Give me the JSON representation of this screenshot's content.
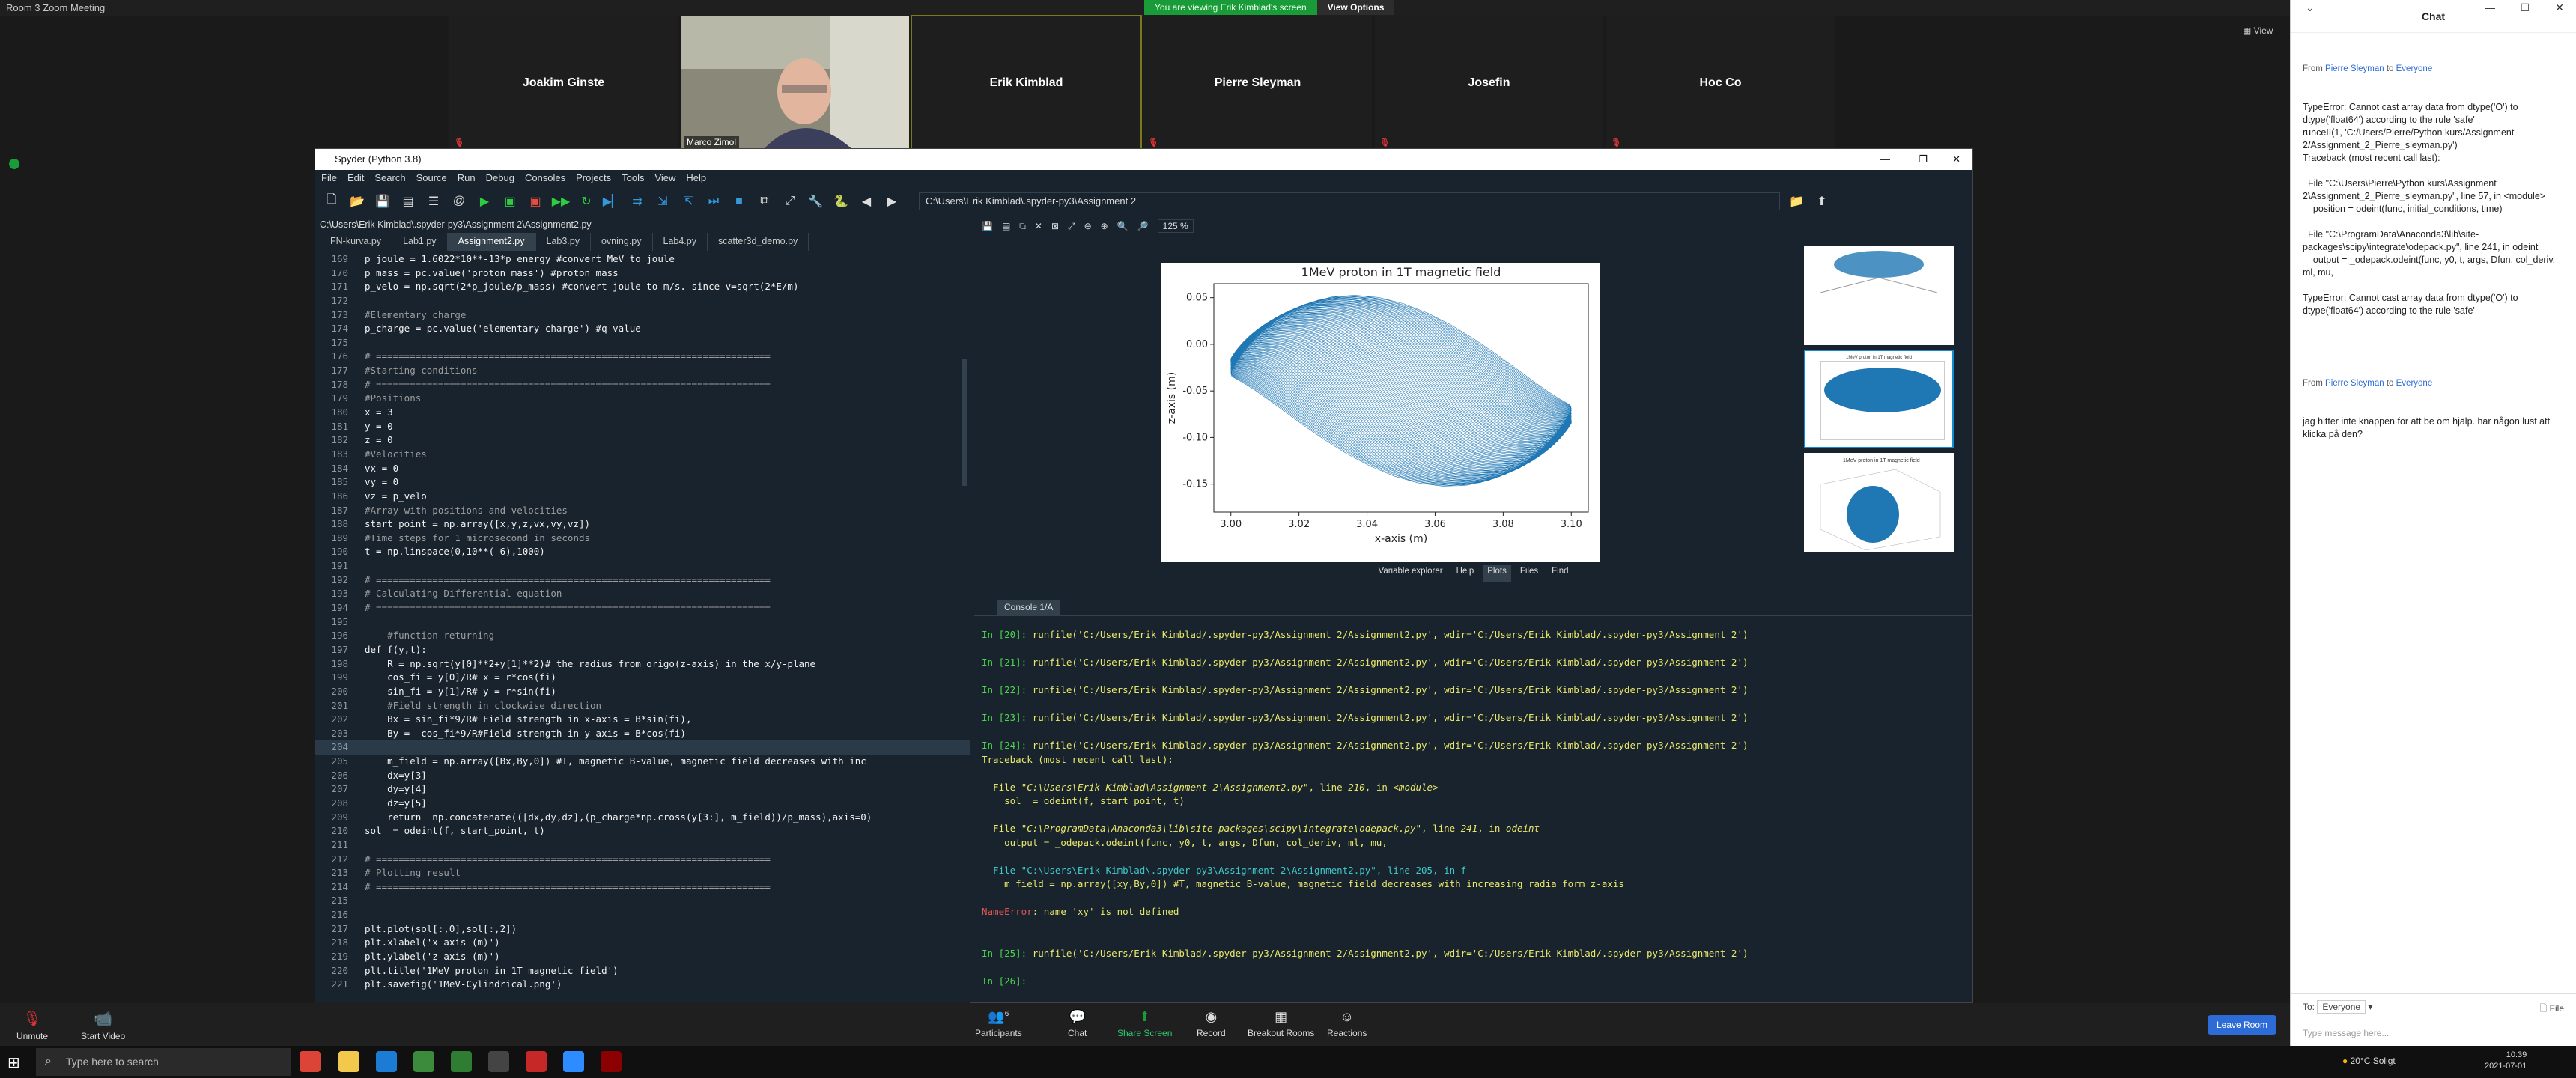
{
  "zoom": {
    "window_title": "Room 3  Zoom Meeting",
    "share_banner": "You are viewing Erik Kimblad's screen",
    "view_options": "View Options",
    "view_label": "View",
    "participants": [
      {
        "name": "Joakim Ginste",
        "muted": true,
        "video": false
      },
      {
        "name": "Marco Zimol",
        "muted": false,
        "video": true
      },
      {
        "name": "Erik Kimblad",
        "muted": false,
        "video": false,
        "active": true
      },
      {
        "name": "Pierre Sleyman",
        "muted": true,
        "video": false
      },
      {
        "name": "Josefin",
        "muted": true,
        "video": false
      },
      {
        "name": "Hoc Co",
        "muted": true,
        "video": false
      }
    ],
    "bottom": {
      "unmute": "Unmute",
      "start_video": "Start Video",
      "participants": "Participants",
      "participants_count": "6",
      "chat": "Chat",
      "share_screen": "Share Screen",
      "record": "Record",
      "breakout": "Breakout Rooms",
      "reactions": "Reactions",
      "leave": "Leave Room"
    }
  },
  "chat": {
    "title": "Chat",
    "messages": [
      {
        "from": "Pierre Sleyman",
        "to": "Everyone",
        "text": "TypeError: Cannot cast array data from dtype('O') to dtype('float64') according to the rule 'safe'\nrunceII(1, 'C:/Users/Pierre/Python kurs/Assignment 2/Assignment_2_Pierre_sleyman.py')\nTraceback (most recent call last):\n\n  File \"C:\\Users\\Pierre\\Python kurs\\Assignment 2\\Assignment_2_Pierre_sleyman.py\", line 57, in <module>\n    position = odeint(func, initial_conditions, time)\n\n  File \"C:\\ProgramData\\Anaconda3\\lib\\site-packages\\scipy\\integrate\\odepack.py\", line 241, in odeint\n    output = _odepack.odeint(func, y0, t, args, Dfun, col_deriv, ml, mu,\n\nTypeError: Cannot cast array data from dtype('O') to dtype('float64') according to the rule 'safe'"
      },
      {
        "from": "Pierre Sleyman",
        "to": "Everyone",
        "text": "jag hitter inte knappen för att be om hjälp. har någon lust att klicka på den?"
      }
    ],
    "to_label": "To:",
    "to_value": "Everyone",
    "file_label": "File",
    "input_placeholder": "Type message here..."
  },
  "spyder": {
    "title": "Spyder (Python 3.8)",
    "menu": [
      "File",
      "Edit",
      "Search",
      "Source",
      "Run",
      "Debug",
      "Consoles",
      "Projects",
      "Tools",
      "View",
      "Help"
    ],
    "path": "C:\\Users\\Erik Kimblad\\.spyder-py3\\Assignment 2",
    "file_path": "C:\\Users\\Erik Kimblad\\.spyder-py3\\Assignment 2\\Assignment2.py",
    "tabs": [
      "FN-kurva.py",
      "Lab1.py",
      "Assignment2.py",
      "Lab3.py",
      "ovning.py",
      "Lab4.py",
      "scatter3d_demo.py"
    ],
    "selected_tab": "Assignment2.py",
    "code": [
      {
        "n": "169",
        "t": "p_joule = 1.6022*10**-13*p_energy #convert MeV to joule"
      },
      {
        "n": "170",
        "t": "p_mass = pc.value('proton mass') #proton mass"
      },
      {
        "n": "171",
        "t": "p_velo = np.sqrt(2*p_joule/p_mass) #convert joule to m/s. since v=sqrt(2*E/m)"
      },
      {
        "n": "172",
        "t": ""
      },
      {
        "n": "173",
        "t": "#Elementary charge"
      },
      {
        "n": "174",
        "t": "p_charge = pc.value('elementary charge') #q-value"
      },
      {
        "n": "175",
        "t": ""
      },
      {
        "n": "176",
        "t": "# ======================================================================"
      },
      {
        "n": "177",
        "t": "#Starting conditions"
      },
      {
        "n": "178",
        "t": "# ======================================================================"
      },
      {
        "n": "179",
        "t": "#Positions"
      },
      {
        "n": "180",
        "t": "x = 3"
      },
      {
        "n": "181",
        "t": "y = 0"
      },
      {
        "n": "182",
        "t": "z = 0"
      },
      {
        "n": "183",
        "t": "#Velocities"
      },
      {
        "n": "184",
        "t": "vx = 0"
      },
      {
        "n": "185",
        "t": "vy = 0"
      },
      {
        "n": "186",
        "t": "vz = p_velo"
      },
      {
        "n": "187",
        "t": "#Array with positions and velocities"
      },
      {
        "n": "188",
        "t": "start_point = np.array([x,y,z,vx,vy,vz])"
      },
      {
        "n": "189",
        "t": "#Time steps for 1 microsecond in seconds"
      },
      {
        "n": "190",
        "t": "t = np.linspace(0,10**(-6),1000)"
      },
      {
        "n": "191",
        "t": ""
      },
      {
        "n": "192",
        "t": "# ======================================================================"
      },
      {
        "n": "193",
        "t": "# Calculating Differential equation"
      },
      {
        "n": "194",
        "t": "# ======================================================================"
      },
      {
        "n": "195",
        "t": ""
      },
      {
        "n": "196",
        "t": "    #function returning"
      },
      {
        "n": "197",
        "t": "def f(y,t):"
      },
      {
        "n": "198",
        "t": "    R = np.sqrt(y[0]**2+y[1]**2)# the radius from origo(z-axis) in the x/y-plane"
      },
      {
        "n": "199",
        "t": "    cos_fi = y[0]/R# x = r*cos(fi)"
      },
      {
        "n": "200",
        "t": "    sin_fi = y[1]/R# y = r*sin(fi)"
      },
      {
        "n": "201",
        "t": "    #Field strength in clockwise direction"
      },
      {
        "n": "202",
        "t": "    Bx = sin_fi*9/R# Field strength in x-axis = B*sin(fi),"
      },
      {
        "n": "203",
        "t": "    By = -cos_fi*9/R#Field strength in y-axis = B*cos(fi)"
      },
      {
        "n": "204",
        "t": ""
      },
      {
        "n": "205",
        "t": "    m_field = np.array([Bx,By,0]) #T, magnetic B-value, magnetic field decreases with inc"
      },
      {
        "n": "206",
        "t": "    dx=y[3]"
      },
      {
        "n": "207",
        "t": "    dy=y[4]"
      },
      {
        "n": "208",
        "t": "    dz=y[5]"
      },
      {
        "n": "209",
        "t": "    return  np.concatenate(([dx,dy,dz],(p_charge*np.cross(y[3:], m_field))/p_mass),axis=0)"
      },
      {
        "n": "210",
        "t": "sol  = odeint(f, start_point, t)"
      },
      {
        "n": "211",
        "t": ""
      },
      {
        "n": "212",
        "t": "# ======================================================================"
      },
      {
        "n": "213",
        "t": "# Plotting result"
      },
      {
        "n": "214",
        "t": "# ======================================================================"
      },
      {
        "n": "215",
        "t": ""
      },
      {
        "n": "216",
        "t": ""
      },
      {
        "n": "217",
        "t": "plt.plot(sol[:,0],sol[:,2])"
      },
      {
        "n": "218",
        "t": "plt.xlabel('x-axis (m)')"
      },
      {
        "n": "219",
        "t": "plt.ylabel('z-axis (m)')"
      },
      {
        "n": "220",
        "t": "plt.title('1MeV proton in 1T magnetic field')"
      },
      {
        "n": "221",
        "t": "plt.savefig('1MeV-Cylindrical.png')"
      }
    ],
    "zoom_level": "125 %",
    "plot_tabs": [
      "Variable explorer",
      "Help",
      "Plots",
      "Files",
      "Find"
    ],
    "selected_plot_tab": "Plots",
    "thumb_titles": [
      "",
      "1MeV proton in 1T magnetic field",
      "1MeV proton in 1T magnetic field"
    ],
    "console_tab": "Console 1/A",
    "console": [
      {
        "cls": "mix",
        "parts": [
          [
            "pr",
            "In [20]: "
          ],
          [
            "yl",
            "runfile('C:/Users/Erik Kimblad/.spyder-py3/Assignment 2/Assignment2.py', wdir='C:/Users/Erik Kimblad/.spyder-py3/Assignment 2')"
          ]
        ]
      },
      {
        "cls": "mix",
        "parts": []
      },
      {
        "cls": "mix",
        "parts": [
          [
            "pr",
            "In [21]: "
          ],
          [
            "yl",
            "runfile('C:/Users/Erik Kimblad/.spyder-py3/Assignment 2/Assignment2.py', wdir='C:/Users/Erik Kimblad/.spyder-py3/Assignment 2')"
          ]
        ]
      },
      {
        "cls": "mix",
        "parts": []
      },
      {
        "cls": "mix",
        "parts": [
          [
            "pr",
            "In [22]: "
          ],
          [
            "yl",
            "runfile('C:/Users/Erik Kimblad/.spyder-py3/Assignment 2/Assignment2.py', wdir='C:/Users/Erik Kimblad/.spyder-py3/Assignment 2')"
          ]
        ]
      },
      {
        "cls": "mix",
        "parts": []
      },
      {
        "cls": "mix",
        "parts": [
          [
            "pr",
            "In [23]: "
          ],
          [
            "yl",
            "runfile('C:/Users/Erik Kimblad/.spyder-py3/Assignment 2/Assignment2.py', wdir='C:/Users/Erik Kimblad/.spyder-py3/Assignment 2')"
          ]
        ]
      },
      {
        "cls": "mix",
        "parts": []
      },
      {
        "cls": "mix",
        "parts": [
          [
            "pr",
            "In [24]: "
          ],
          [
            "yl",
            "runfile('C:/Users/Erik Kimblad/.spyder-py3/Assignment 2/Assignment2.py', wdir='C:/Users/Erik Kimblad/.spyder-py3/Assignment 2')"
          ]
        ]
      },
      {
        "cls": "mix",
        "parts": [
          [
            "yl",
            "Traceback (most recent call last):"
          ]
        ]
      },
      {
        "cls": "mix",
        "parts": []
      },
      {
        "cls": "mix",
        "parts": [
          [
            "yl",
            "  File "
          ],
          [
            "it",
            "\"C:\\Users\\Erik Kimblad\\Assignment 2\\Assignment2.py\""
          ],
          [
            "yl",
            ", line "
          ],
          [
            "it",
            "210"
          ],
          [
            "yl",
            ", in "
          ],
          [
            "it",
            "<module>"
          ]
        ]
      },
      {
        "cls": "mix",
        "parts": [
          [
            "yl",
            "    sol  = odeint(f, start_point, t)"
          ]
        ]
      },
      {
        "cls": "mix",
        "parts": []
      },
      {
        "cls": "mix",
        "parts": [
          [
            "yl",
            "  File "
          ],
          [
            "it",
            "\"C:\\ProgramData\\Anaconda3\\lib\\site-packages\\scipy\\integrate\\odepack.py\""
          ],
          [
            "yl",
            ", line "
          ],
          [
            "it",
            "241"
          ],
          [
            "yl",
            ", in "
          ],
          [
            "it",
            "odeint"
          ]
        ]
      },
      {
        "cls": "mix",
        "parts": [
          [
            "yl",
            "    output = _odepack.odeint(func, y0, t, args, Dfun, col_deriv, ml, mu,"
          ]
        ]
      },
      {
        "cls": "mix",
        "parts": []
      },
      {
        "cls": "mix",
        "parts": [
          [
            "cy",
            "  File \"C:\\Users\\Erik Kimblad\\.spyder-py3\\Assignment 2\\Assignment2.py\", line 205, in f"
          ]
        ]
      },
      {
        "cls": "mix",
        "parts": [
          [
            "yl",
            "    m_field = np.array([xy,By,0]) #T, magnetic B-value, magnetic field decreases with increasing radia form z-axis"
          ]
        ]
      },
      {
        "cls": "mix",
        "parts": []
      },
      {
        "cls": "mix",
        "parts": [
          [
            "rd",
            "NameError"
          ],
          [
            "yl",
            ": name 'xy' is not defined"
          ]
        ]
      },
      {
        "cls": "mix",
        "parts": []
      },
      {
        "cls": "mix",
        "parts": []
      },
      {
        "cls": "mix",
        "parts": [
          [
            "pr",
            "In [25]: "
          ],
          [
            "yl",
            "runfile('C:/Users/Erik Kimblad/.spyder-py3/Assignment 2/Assignment2.py', wdir='C:/Users/Erik Kimblad/.spyder-py3/Assignment 2')"
          ]
        ]
      },
      {
        "cls": "mix",
        "parts": []
      },
      {
        "cls": "mix",
        "parts": [
          [
            "pr",
            "In [26]: "
          ]
        ]
      }
    ]
  },
  "chart_data": {
    "type": "line",
    "title": "1MeV proton in 1T magnetic field",
    "xlabel": "x-axis (m)",
    "ylabel": "z-axis (m)",
    "xlim": [
      2.995,
      3.105
    ],
    "ylim": [
      -0.18,
      0.065
    ],
    "xticks": [
      "3.00",
      "3.02",
      "3.04",
      "3.06",
      "3.08",
      "3.10"
    ],
    "yticks": [
      "0.05",
      "0.00",
      "-0.05",
      "-0.10",
      "-0.15"
    ],
    "color": "#1f77b4",
    "description_note": "dense helical oscillation between x=3.00 and x=3.10 while z decreases from 0.05 to -0.15"
  },
  "taskbar": {
    "search_placeholder": "Type here to search",
    "weather": "20°C  Soligt",
    "time": "10:39",
    "date": "2021-07-01"
  }
}
